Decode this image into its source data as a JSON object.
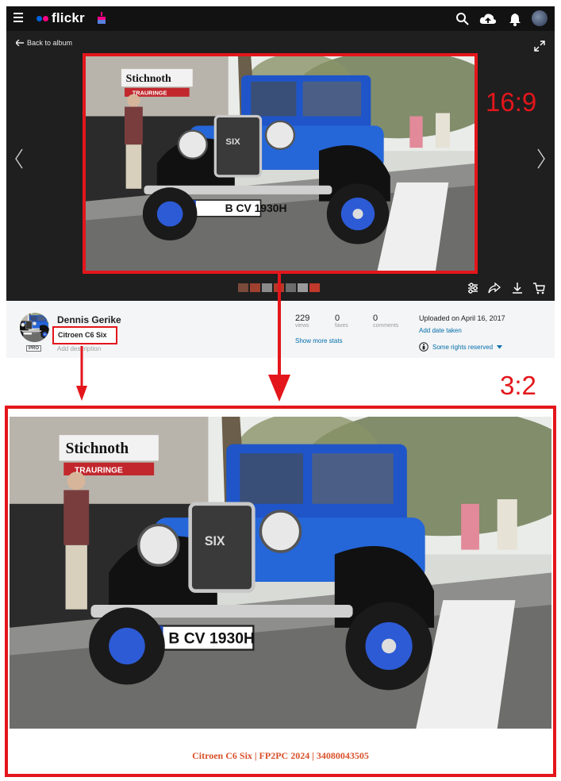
{
  "header": {
    "logo_text": "flickr",
    "icons": [
      "menu-icon",
      "search-icon",
      "upload-icon",
      "notification-bell-icon",
      "user-avatar"
    ]
  },
  "viewer": {
    "back_label": "Back to album",
    "tools": [
      "settings-sliders-icon",
      "share-icon",
      "download-icon",
      "cart-icon"
    ]
  },
  "photo_info": {
    "author": "Dennis Gerike",
    "pro_badge": "PRO",
    "title": "Citroen C6 Six",
    "description_placeholder": "Add description",
    "stats": [
      {
        "value": "229",
        "label": "views"
      },
      {
        "value": "0",
        "label": "faves"
      },
      {
        "value": "0",
        "label": "comments"
      }
    ],
    "show_more_stats": "Show more stats",
    "uploaded": "Uploaded on April 16, 2017",
    "add_date_taken": "Add date taken",
    "license": "Some rights reserved"
  },
  "annotations": {
    "ratio_top": "16:9",
    "ratio_bottom": "3:2",
    "color": "#e3161b"
  },
  "crop_preview": {
    "caption": "Citroen C6 Six | FP2PC 2024 | 34080043505",
    "caption_color": "#d8502a"
  },
  "photo": {
    "license_plate": "B CV 1930H",
    "grille_badge": "SIX",
    "shop_sign": "Stichnoth",
    "shop_subsign": "TRAURINGE"
  }
}
